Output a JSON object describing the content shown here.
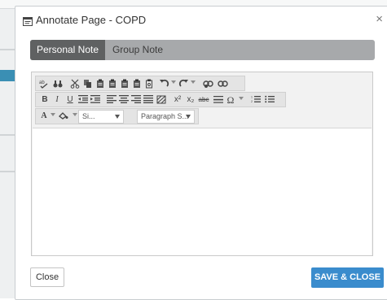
{
  "dialog": {
    "title": "Annotate Page - COPD",
    "close_glyph": "×",
    "title_icon": "window-icon"
  },
  "tabs": [
    {
      "label": "Personal Note",
      "active": true
    },
    {
      "label": "Group Note",
      "active": false
    }
  ],
  "toolbar": {
    "row1": [
      "spellcheck-icon",
      "find-icon",
      "cut-icon",
      "copy-icon",
      "paste-icon",
      "paste-text-icon",
      "paste-word-icon",
      "paste-html-icon",
      "paste-format-icon",
      "undo-icon",
      "redo-icon",
      "link-icon",
      "unlink-icon"
    ],
    "row2": {
      "bold": "B",
      "italic": "I",
      "underline": "U",
      "superscript": "x²",
      "subscript": "x₂",
      "strike": "abc",
      "symbol": "Ω"
    },
    "row3": {
      "font_color_label": "A",
      "font_size_value": "Si...",
      "paragraph_value": "Paragraph S..."
    }
  },
  "editor": {
    "content": ""
  },
  "buttons": {
    "close": "Close",
    "save_close": "SAVE & CLOSE"
  },
  "colors": {
    "accent": "#3a8ccd",
    "tab_active": "#5f6162",
    "tab_bar": "#a7a9ab"
  }
}
